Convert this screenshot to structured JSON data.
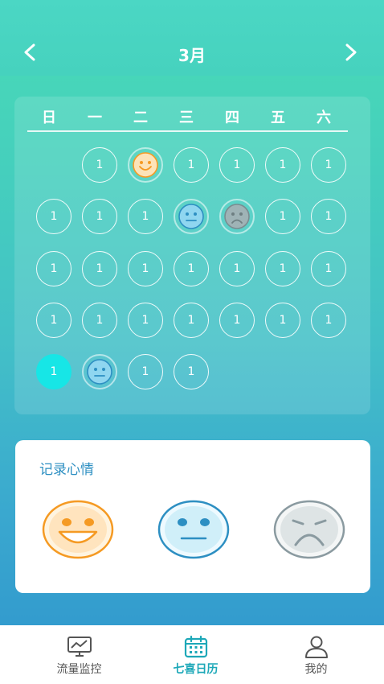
{
  "header": {
    "month": "3月"
  },
  "weekdays": [
    "日",
    "一",
    "二",
    "三",
    "四",
    "五",
    "六"
  ],
  "days": [
    {
      "row": 0,
      "col": 1,
      "label": "1"
    },
    {
      "row": 0,
      "col": 2,
      "mood": "happy"
    },
    {
      "row": 0,
      "col": 3,
      "label": "1"
    },
    {
      "row": 0,
      "col": 4,
      "label": "1"
    },
    {
      "row": 0,
      "col": 5,
      "label": "1"
    },
    {
      "row": 0,
      "col": 6,
      "label": "1"
    },
    {
      "row": 1,
      "col": 0,
      "label": "1"
    },
    {
      "row": 1,
      "col": 1,
      "label": "1"
    },
    {
      "row": 1,
      "col": 2,
      "label": "1"
    },
    {
      "row": 1,
      "col": 3,
      "mood": "neutral"
    },
    {
      "row": 1,
      "col": 4,
      "mood": "sad"
    },
    {
      "row": 1,
      "col": 5,
      "label": "1"
    },
    {
      "row": 1,
      "col": 6,
      "label": "1"
    },
    {
      "row": 2,
      "col": 0,
      "label": "1"
    },
    {
      "row": 2,
      "col": 1,
      "label": "1"
    },
    {
      "row": 2,
      "col": 2,
      "label": "1"
    },
    {
      "row": 2,
      "col": 3,
      "label": "1"
    },
    {
      "row": 2,
      "col": 4,
      "label": "1"
    },
    {
      "row": 2,
      "col": 5,
      "label": "1"
    },
    {
      "row": 2,
      "col": 6,
      "label": "1"
    },
    {
      "row": 3,
      "col": 0,
      "label": "1"
    },
    {
      "row": 3,
      "col": 1,
      "label": "1"
    },
    {
      "row": 3,
      "col": 2,
      "label": "1"
    },
    {
      "row": 3,
      "col": 3,
      "label": "1"
    },
    {
      "row": 3,
      "col": 4,
      "label": "1"
    },
    {
      "row": 3,
      "col": 5,
      "label": "1"
    },
    {
      "row": 3,
      "col": 6,
      "label": "1"
    },
    {
      "row": 4,
      "col": 0,
      "label": "1",
      "today": true
    },
    {
      "row": 4,
      "col": 1,
      "mood": "neutral"
    },
    {
      "row": 4,
      "col": 2,
      "label": "1"
    },
    {
      "row": 4,
      "col": 3,
      "label": "1"
    }
  ],
  "mood_panel": {
    "title": "记录心情",
    "options": [
      {
        "name": "happy",
        "icon": "happy-face-icon"
      },
      {
        "name": "neutral",
        "icon": "neutral-face-icon"
      },
      {
        "name": "sad",
        "icon": "sad-face-icon"
      }
    ]
  },
  "tabbar": [
    {
      "label": "流量监控",
      "icon": "monitor-chart-icon",
      "active": false
    },
    {
      "label": "七喜日历",
      "icon": "calendar-icon",
      "active": true
    },
    {
      "label": "我的",
      "icon": "user-icon",
      "active": false
    }
  ],
  "colors": {
    "accent": "#1da8b8",
    "today": "#17e6e6",
    "happy": "#f59a23",
    "neutral": "#2d8fc2",
    "sad": "#8a9aa0"
  }
}
